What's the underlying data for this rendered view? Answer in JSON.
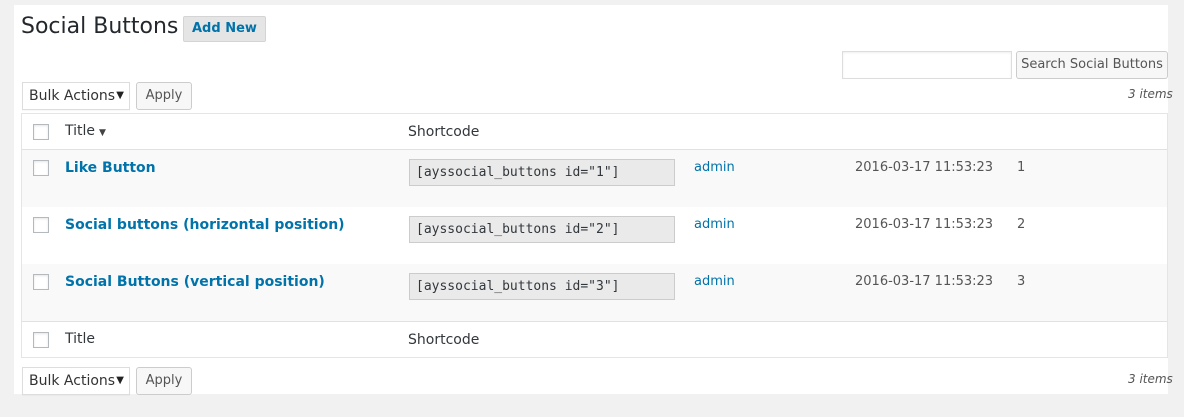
{
  "header": {
    "title": "Social Buttons",
    "add_new_label": "Add New"
  },
  "search": {
    "value": "",
    "button_label": "Search Social Buttons"
  },
  "toolbar_top": {
    "bulk_label": "Bulk Actions",
    "apply_label": "Apply",
    "items_count": "3 items"
  },
  "table": {
    "columns": [
      "Title",
      "Shortcode"
    ],
    "rows": [
      {
        "title": "Like Button",
        "shortcode": "[ayssocial_buttons id=\"1\"]",
        "author": "admin",
        "date": "2016-03-17 11:53:23",
        "id": "1"
      },
      {
        "title": "Social buttons (horizontal position)",
        "shortcode": "[ayssocial_buttons id=\"2\"]",
        "author": "admin",
        "date": "2016-03-17 11:53:23",
        "id": "2"
      },
      {
        "title": "Social Buttons (vertical position)",
        "shortcode": "[ayssocial_buttons id=\"3\"]",
        "author": "admin",
        "date": "2016-03-17 11:53:23",
        "id": "3"
      }
    ]
  },
  "toolbar_bottom": {
    "bulk_label": "Bulk Actions",
    "apply_label": "Apply",
    "items_count": "3 items"
  },
  "icons": {
    "sort": "sort-down-icon",
    "dropdown": "dropdown-arrow-icon"
  },
  "colors": {
    "link": "#0073aa",
    "background": "#f1f1f1",
    "panel": "#ffffff"
  }
}
